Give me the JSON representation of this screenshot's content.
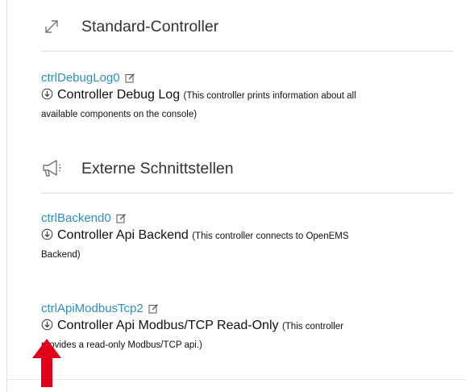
{
  "sections": [
    {
      "icon": "resize-diagonal-icon",
      "title": "Standard-Controller",
      "items": [
        {
          "id_link": "ctrlDebugLog0",
          "title": "Controller Debug Log",
          "note_line1": "(This controller prints information about all",
          "note_line2": "available components on the console)"
        }
      ]
    },
    {
      "icon": "megaphone-icon",
      "title": "Externe Schnittstellen",
      "items": [
        {
          "id_link": "ctrlBackend0",
          "title": "Controller Api Backend",
          "note_line1": "(This controller connects to OpenEMS",
          "note_line2": "Backend)"
        },
        {
          "id_link": "ctrlApiModbusTcp2",
          "title": "Controller Api Modbus/TCP Read-Only",
          "note_line1": "(This controller",
          "note_line2": "provides a read-only Modbus/TCP api.)"
        }
      ]
    }
  ],
  "colors": {
    "link": "#2e8ec4",
    "arrow": "#e3001b"
  }
}
